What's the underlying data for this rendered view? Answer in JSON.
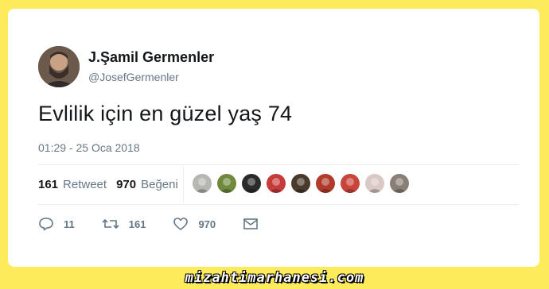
{
  "tweet": {
    "display_name": "J.Şamil Germenler",
    "handle": "@JosefGermenler",
    "text": "Evlilik için en güzel yaş 74",
    "timestamp": "01:29 - 25 Oca 2018"
  },
  "stats": {
    "retweet_count": "161",
    "retweet_label": "Retweet",
    "like_count": "970",
    "like_label": "Beğeni"
  },
  "actions": {
    "reply_count": "11",
    "retweet_count": "161",
    "like_count": "970"
  },
  "likers": [
    {
      "icon": "avatar",
      "color": "#b7b7b1"
    },
    {
      "icon": "avatar",
      "color": "#6f8a3e"
    },
    {
      "icon": "avatar",
      "color": "#2b2b2b"
    },
    {
      "icon": "avatar",
      "color": "#c73a3a"
    },
    {
      "icon": "avatar",
      "color": "#4a3a2c"
    },
    {
      "icon": "avatar",
      "color": "#b13a2a"
    },
    {
      "icon": "avatar",
      "color": "#c9443a"
    },
    {
      "icon": "avatar",
      "color": "#d9c8c4"
    },
    {
      "icon": "avatar",
      "color": "#8a7f76"
    }
  ],
  "watermark": "mizahtimarhanesi.com",
  "colors": {
    "background": "#fdeb5b",
    "card": "#ffffff",
    "text": "#14171a",
    "muted": "#657786"
  }
}
